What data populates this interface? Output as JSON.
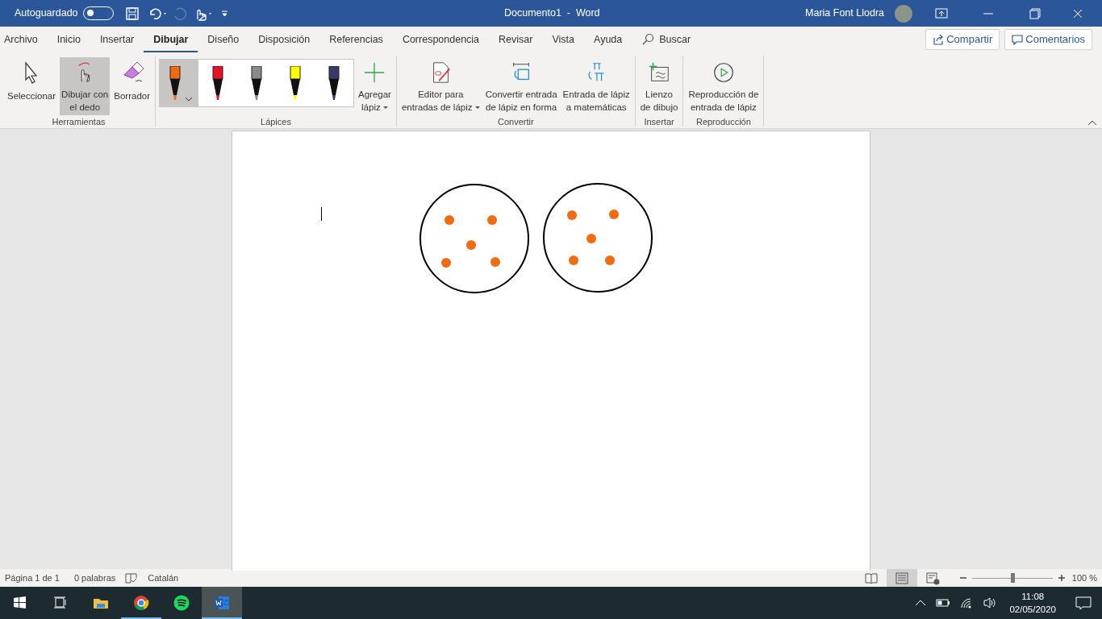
{
  "title_bar": {
    "autosave_label": "Autoguardado",
    "autosave_on": false,
    "document_title": "Documento1  -  Word",
    "user_name": "Maria Font Llodra"
  },
  "menu_tabs": [
    {
      "label": "Archivo",
      "selected": false
    },
    {
      "label": "Inicio",
      "selected": false
    },
    {
      "label": "Insertar",
      "selected": false
    },
    {
      "label": "Dibujar",
      "selected": true
    },
    {
      "label": "Diseño",
      "selected": false
    },
    {
      "label": "Disposición",
      "selected": false
    },
    {
      "label": "Referencias",
      "selected": false
    },
    {
      "label": "Correspondencia",
      "selected": false
    },
    {
      "label": "Revisar",
      "selected": false
    },
    {
      "label": "Vista",
      "selected": false
    },
    {
      "label": "Ayuda",
      "selected": false
    }
  ],
  "search": {
    "placeholder": "Buscar"
  },
  "share_button": "Compartir",
  "comments_button": "Comentarios",
  "ribbon_groups": [
    {
      "label": "Herramientas",
      "items": [
        {
          "kind": "select",
          "lines": [
            "Seleccionar"
          ],
          "selected": false,
          "dropdown": false
        },
        {
          "kind": "finger",
          "lines": [
            "Dibujar con",
            "el dedo"
          ],
          "selected": true,
          "dropdown": false
        },
        {
          "kind": "eraser",
          "lines": [
            "Borrador"
          ],
          "selected": false,
          "dropdown": false
        }
      ]
    },
    {
      "label": "Lápices",
      "pens": [
        {
          "color": "#f26b0f",
          "selected": true
        },
        {
          "color": "#e81123",
          "selected": false
        },
        {
          "color": "#8a8a8a",
          "selected": false
        },
        {
          "color": "#ffff00",
          "selected": false
        },
        {
          "color": "#3a3a6a",
          "selected": false
        }
      ],
      "items": [
        {
          "kind": "add",
          "lines": [
            "Agregar",
            "lápiz"
          ],
          "selected": false,
          "dropdown": true
        }
      ]
    },
    {
      "label": "Convertir",
      "items": [
        {
          "kind": "editor",
          "lines": [
            "Editor para",
            "entradas de lápiz"
          ],
          "selected": false,
          "dropdown": true
        },
        {
          "kind": "shape",
          "lines": [
            "Convertir entrada",
            "de lápiz en forma"
          ],
          "selected": false,
          "dropdown": false
        },
        {
          "kind": "math",
          "lines": [
            "Entrada de lápiz",
            "a matemáticas"
          ],
          "selected": false,
          "dropdown": false
        }
      ]
    },
    {
      "label": "Insertar",
      "items": [
        {
          "kind": "canvas",
          "lines": [
            "Lienzo",
            "de dibujo"
          ],
          "selected": false,
          "dropdown": false
        }
      ]
    },
    {
      "label": "Reproducción",
      "items": [
        {
          "kind": "replay",
          "lines": [
            "Reproducción de",
            "entrada de lápiz"
          ],
          "selected": false,
          "dropdown": false
        }
      ]
    }
  ],
  "status_bar": {
    "page": "Página 1 de 1",
    "words": "0 palabras",
    "language": "Catalán",
    "views": [
      {
        "kind": "read",
        "selected": false
      },
      {
        "kind": "print",
        "selected": true
      },
      {
        "kind": "web",
        "selected": false
      }
    ],
    "zoom": {
      "level": 0.5,
      "reading": "100 %"
    }
  },
  "taskbar": {
    "apps": [
      {
        "kind": "start",
        "running": false,
        "selected": false
      },
      {
        "kind": "taskview",
        "running": false,
        "selected": false
      },
      {
        "kind": "explorer",
        "running": false,
        "selected": false
      },
      {
        "kind": "chrome",
        "running": true,
        "selected": false
      },
      {
        "kind": "spotify",
        "running": false,
        "selected": false
      },
      {
        "kind": "word",
        "running": true,
        "selected": true
      }
    ],
    "time": "11:08",
    "date": "02/05/2020"
  }
}
